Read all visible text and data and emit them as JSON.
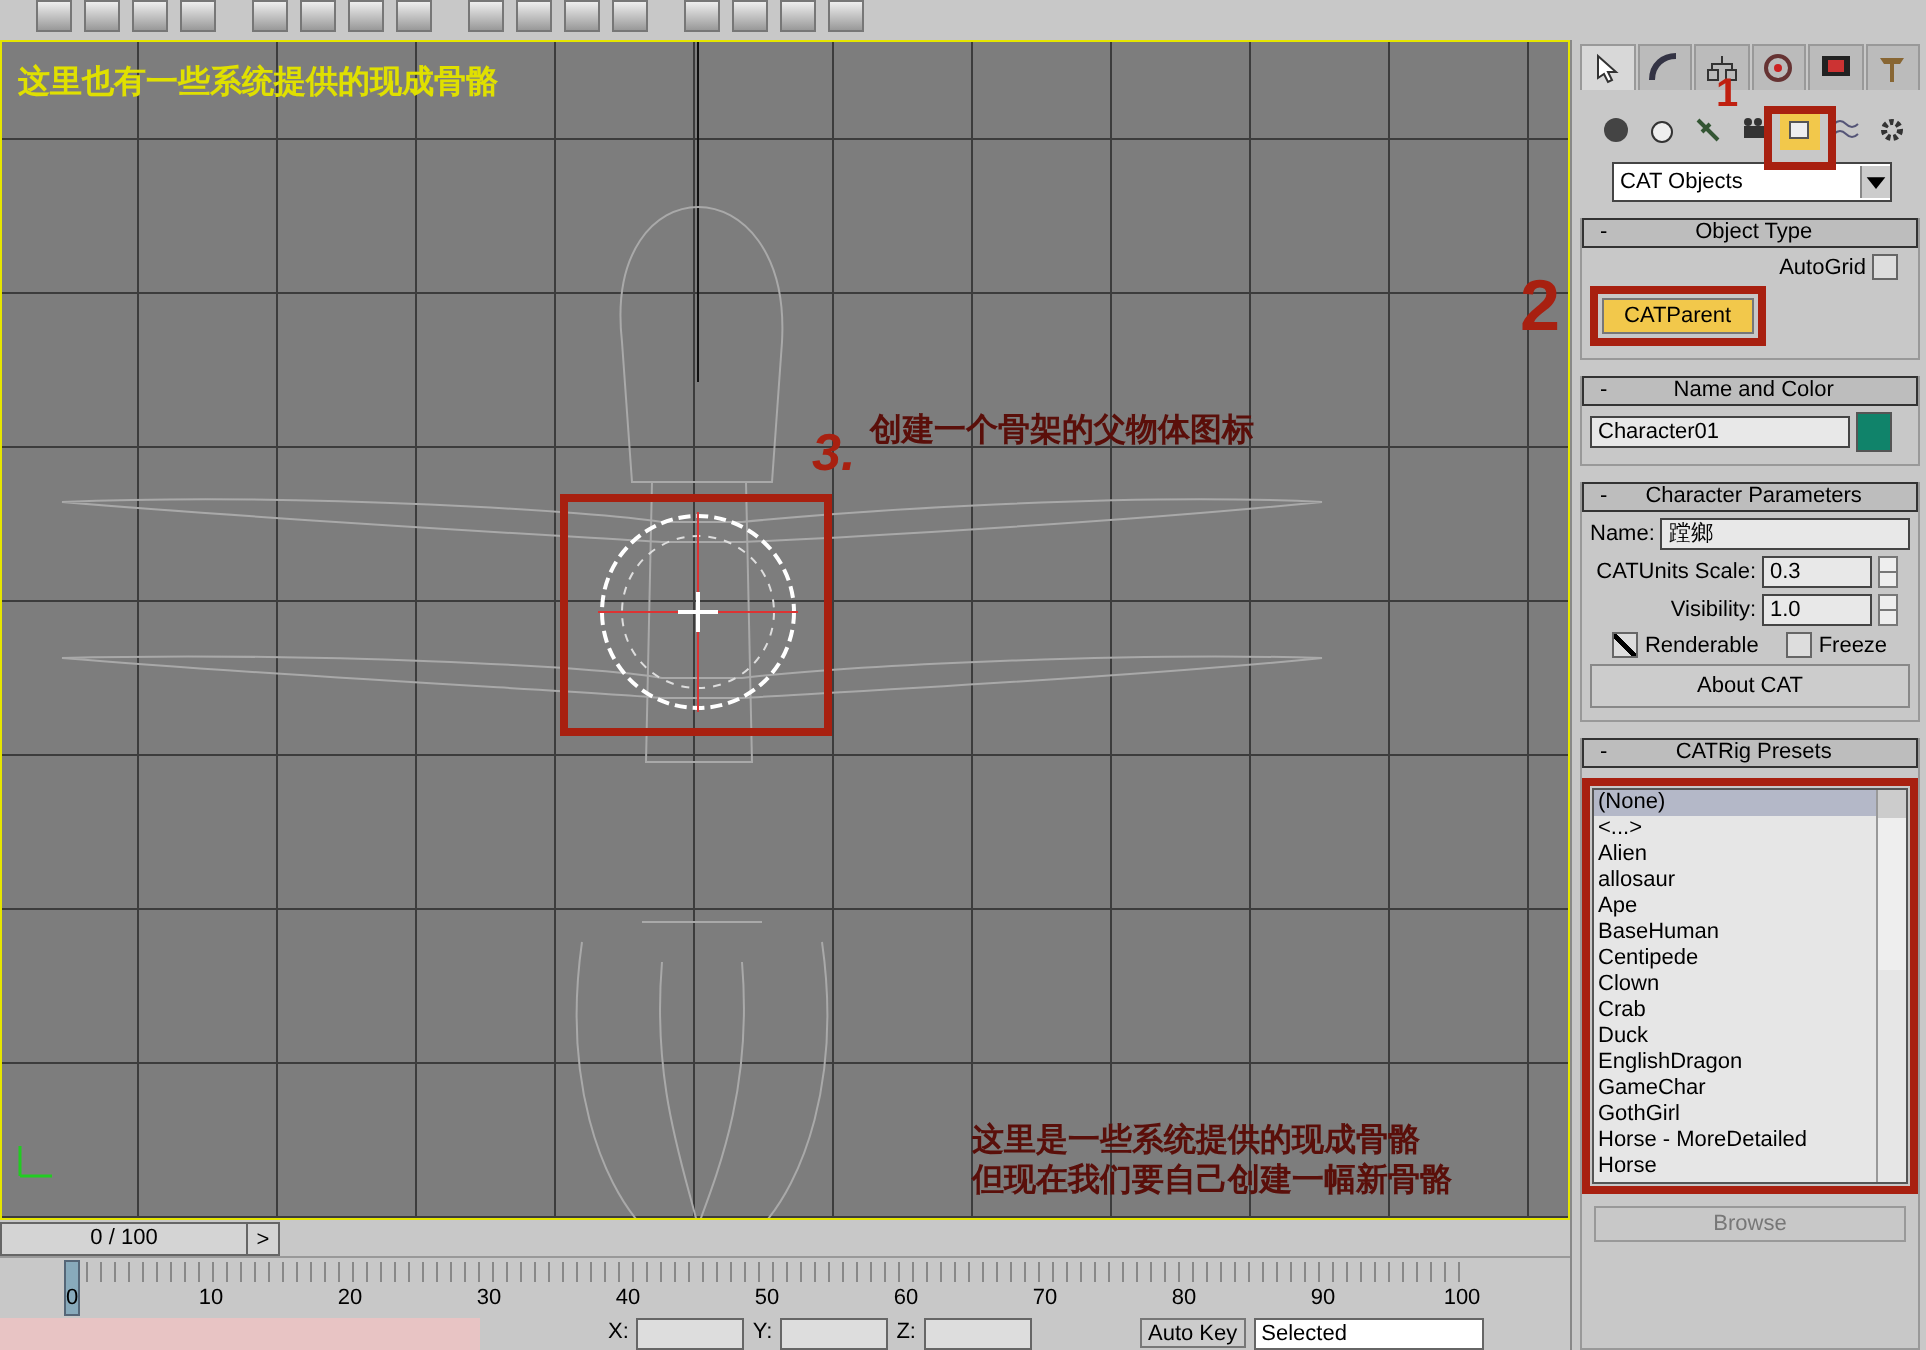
{
  "viewport": {
    "caption": "这里也有一些系统提供的现成骨骼",
    "step_mark": "3.",
    "step_text": "创建一个骨架的父物体图标",
    "note_lines": [
      "这里是一些系统提供的现成骨骼",
      "但现在我们要自己创建一幅新骨骼"
    ]
  },
  "markers": [
    "1",
    "2"
  ],
  "command_panel": {
    "tabs": [
      {
        "selected": true
      },
      {
        "selected": false
      },
      {
        "selected": false
      },
      {
        "selected": false
      },
      {
        "selected": false
      },
      {
        "selected": false
      }
    ],
    "categories": [
      {
        "selected": false
      },
      {
        "selected": false
      },
      {
        "selected": false
      },
      {
        "selected": false
      },
      {
        "selected": true
      },
      {
        "selected": false
      },
      {
        "selected": false
      }
    ],
    "dropdown": "CAT Objects",
    "object_type": {
      "toggle": "-",
      "title": "Object Type",
      "autogrid_label": "AutoGrid",
      "autogrid_checked": false,
      "button": "CATParent",
      "button_active": true
    },
    "name_color": {
      "toggle": "-",
      "title": "Name and Color",
      "name": "Character01",
      "color": "#10836a"
    },
    "params": {
      "toggle": "-",
      "title": "Character Parameters",
      "name_label": "Name:",
      "name_value": "蹚鄉",
      "scale_label": "CATUnits Scale:",
      "scale_value": "0.3",
      "visibility_label": "Visibility:",
      "visibility_value": "1.0",
      "renderable_label": "Renderable",
      "renderable_checked": true,
      "freeze_label": "Freeze",
      "freeze_checked": false,
      "about_button": "About CAT"
    },
    "presets": {
      "toggle": "-",
      "title": "CATRig Presets",
      "items": [
        {
          "label": "(None)",
          "selected": true
        },
        {
          "label": "<...>",
          "selected": false
        },
        {
          "label": "Alien",
          "selected": false
        },
        {
          "label": "allosaur",
          "selected": false
        },
        {
          "label": "Ape",
          "selected": false
        },
        {
          "label": "BaseHuman",
          "selected": false
        },
        {
          "label": "Centipede",
          "selected": false
        },
        {
          "label": "Clown",
          "selected": false
        },
        {
          "label": "Crab",
          "selected": false
        },
        {
          "label": "Duck",
          "selected": false
        },
        {
          "label": "EnglishDragon",
          "selected": false
        },
        {
          "label": "GameChar",
          "selected": false
        },
        {
          "label": "GothGirl",
          "selected": false
        },
        {
          "label": "Horse - MoreDetailed",
          "selected": false
        },
        {
          "label": "Horse",
          "selected": false
        }
      ],
      "browse": "Browse"
    }
  },
  "timeline": {
    "position": "0 / 100",
    "next": ">",
    "level": 0,
    "ticks": [
      "0",
      "10",
      "20",
      "30",
      "40",
      "50",
      "60",
      "70",
      "80",
      "90",
      "100"
    ]
  },
  "status": {
    "x_label": "X:",
    "y_label": "Y:",
    "z_label": "Z:",
    "auto_key": "Auto Key",
    "key_filter": "Selected"
  }
}
